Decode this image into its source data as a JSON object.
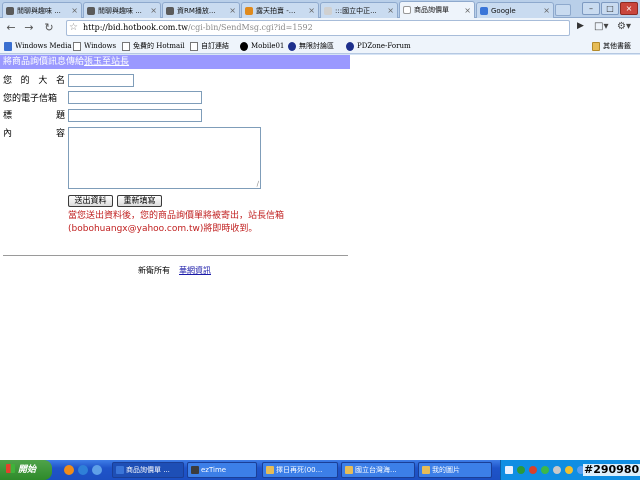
{
  "browser": {
    "tabs": [
      {
        "label": "閒聊與趣味 ...",
        "favicon_color": "#5a5a5a"
      },
      {
        "label": "閒聊與趣味 ...",
        "favicon_color": "#5a5a5a"
      },
      {
        "label": "資RM播放...",
        "favicon_color": "#5a5a5a"
      },
      {
        "label": "露天拍賣 -...",
        "favicon_color": "#e08a1c"
      },
      {
        "label": ":::國立中正...",
        "favicon_color": "#d0d0d0"
      },
      {
        "label": "商品詢價單",
        "favicon_color": "#ffffff",
        "active": true
      },
      {
        "label": "Google",
        "favicon_color": "#3a75d8"
      }
    ],
    "tab_close_glyph": "×",
    "window_buttons": [
      "–",
      "□",
      "×"
    ],
    "url_host": "http://bid.hotbook.com.tw",
    "url_rest": "/cgi-bin/SendMsg.cgi?id=1592",
    "bookmarks": [
      {
        "label": "Windows Media",
        "icon": "media-icon"
      },
      {
        "label": "Windows",
        "icon": "page-icon"
      },
      {
        "label": "免費的 Hotmail",
        "icon": "page-icon"
      },
      {
        "label": "自訂連結",
        "icon": "page-icon"
      },
      {
        "label": "Mobile01",
        "icon": "site-icon"
      },
      {
        "label": "無限討論區",
        "icon": "site-icon"
      },
      {
        "label": "PDZone-Forum",
        "icon": "site-icon"
      }
    ],
    "other_bookmarks": "其他書籤"
  },
  "form": {
    "banner_text": "將商品詢價訊息傳給",
    "banner_link": "張玉至站長",
    "name_label_chars": [
      "您",
      "的",
      "大",
      "名"
    ],
    "email_label": "您的電子信箱",
    "subject_label_chars": [
      "標",
      "題"
    ],
    "content_label_chars": [
      "內",
      "容"
    ],
    "submit_label": "送出資料",
    "reset_label": "重新填寫",
    "notice": "當您送出資料後，您的商品詢價單將被寄出，站長信箱(bobohuangx@yahoo.com.tw)將即時收到。",
    "footer_text": "新衛所有",
    "footer_link": "華網資訊"
  },
  "taskbar": {
    "start_label": "開始",
    "tasks": [
      {
        "label": "商品詢價單 ...",
        "icon_color": "#3a75d8",
        "active": true
      },
      {
        "label": "ezTime",
        "icon_color": "#3c3c3c"
      },
      {
        "label": "擇日再死(00...",
        "icon_color": "#e6bc57"
      },
      {
        "label": "國立台灣海...",
        "icon_color": "#e6bc57"
      },
      {
        "label": "我的圖片",
        "icon_color": "#e6bc57"
      }
    ],
    "watermark": "#290980"
  }
}
